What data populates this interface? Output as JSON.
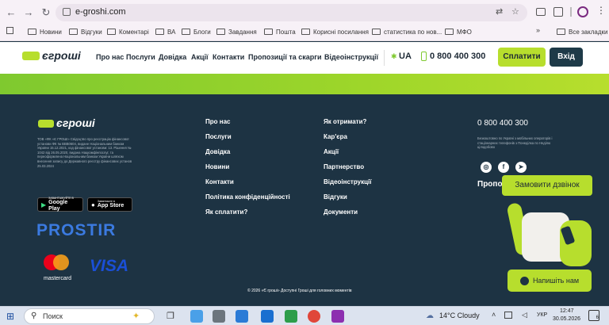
{
  "browser": {
    "url": "e-groshi.com",
    "bookmarks": [
      "Новини",
      "Відгуки",
      "Коментарі",
      "ВА",
      "Блоги",
      "Завдання",
      "Пошта",
      "Корисні посилання",
      "статистика по нов...",
      "МФО"
    ],
    "all_bookmarks": "Все закладки"
  },
  "header": {
    "logo": "єгроші",
    "nav": [
      "Про нас",
      "Послуги",
      "Довідка",
      "Акції",
      "Контакти",
      "Пропозиції та скарги",
      "Відеоінструкції"
    ],
    "lang": "UA",
    "phone": "0 800 400 300",
    "pay_label": "Сплатити",
    "login_label": "Вхід"
  },
  "footer": {
    "logo": "єгроші",
    "legal_text": "ТОВ «ФК «Є ГРОШІ» Свідоцтво про реєстрацію фінансової установи ФК № ВВВ0604, видане Національним банком України 15.12.2021, код фінансової установи: 13. Рішення № 1042 від 26.05.2020, видана Нацкомфінпослуг, та переоформлена Національним банком України шляхом внесення запису до Державного реєстру фінансових установ 25.03.2024",
    "col1": [
      "Про нас",
      "Послуги",
      "Довідка",
      "Новини",
      "Контакти",
      "Політика конфіденційності",
      "Як сплатити?"
    ],
    "col2": [
      "Як отримати?",
      "Кар'єра",
      "Акції",
      "Партнерство",
      "Відеоінструкції",
      "Відгуки",
      "Документи"
    ],
    "phone": "0 800 400 300",
    "phone_note": "Безкоштовно по Україні з мобільних операторів і стаціонарних телефонів з Понеділка по Неділю цілодобово",
    "prop_label": "Пропо",
    "google_play_small": "ЗАВАНТАЖУЙТЕ В",
    "google_play": "Google Play",
    "app_store_small": "Завантажте в",
    "app_store": "App Store",
    "prostir": "PROSTIR",
    "mastercard": "mastercard",
    "visa": "VISA",
    "copyright": "© 2026 «Є гроші» Доступні Гроші для головних моментів",
    "callback_label": "Замовити дзвінок",
    "write_label": "Напишіть нам"
  },
  "taskbar": {
    "search": "Поиск",
    "weather": "14°C  Cloudy",
    "lang": "УКР",
    "time": "12:47",
    "date": "30.05.2026",
    "notif": "6"
  },
  "colors": {
    "brand_green": "#b7de2d",
    "dark_navy": "#1d3343",
    "button_dark": "#1e3a48"
  }
}
